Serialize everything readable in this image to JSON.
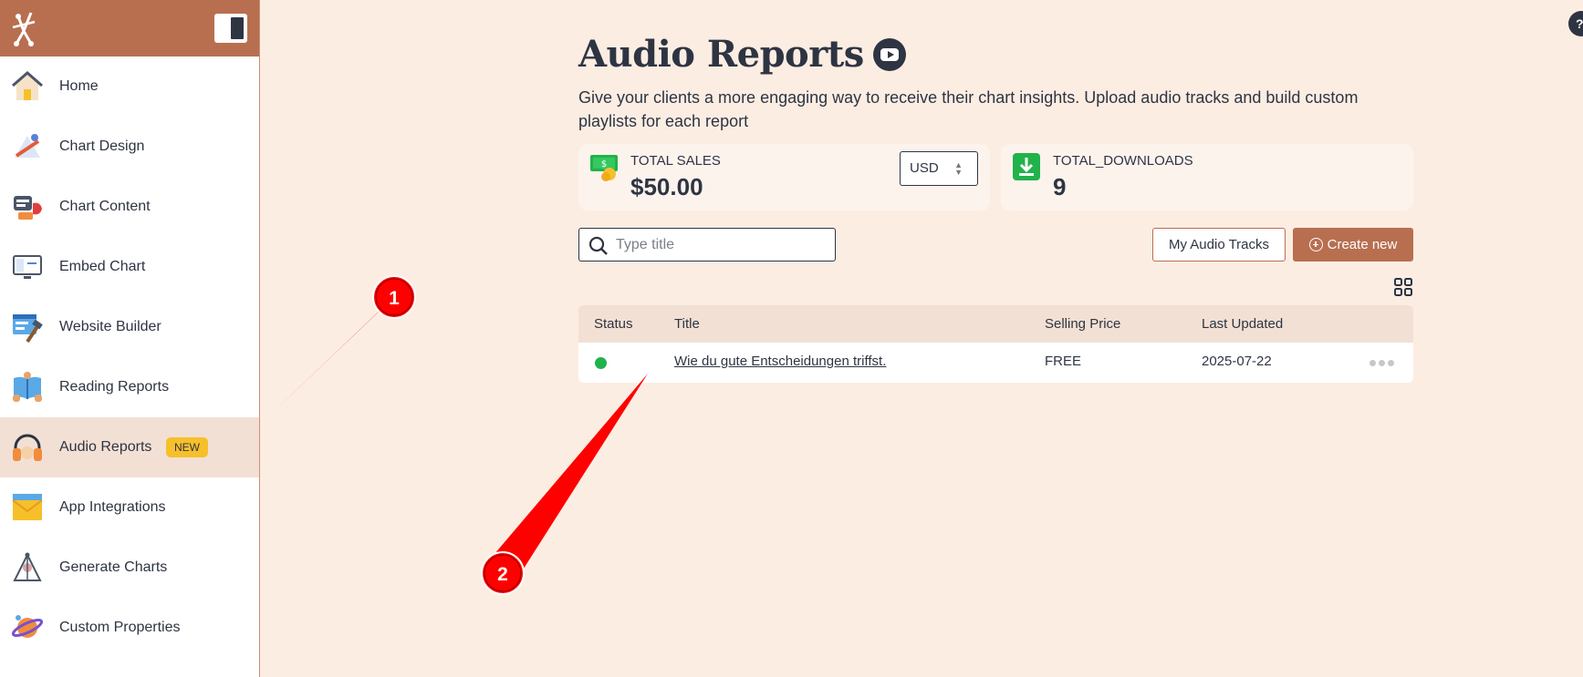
{
  "sidebar": {
    "items": [
      {
        "label": "Home"
      },
      {
        "label": "Chart Design"
      },
      {
        "label": "Chart Content"
      },
      {
        "label": "Embed Chart"
      },
      {
        "label": "Website Builder"
      },
      {
        "label": "Reading Reports"
      },
      {
        "label": "Audio Reports",
        "badge": "NEW",
        "active": true
      },
      {
        "label": "App Integrations"
      },
      {
        "label": "Generate Charts"
      },
      {
        "label": "Custom Properties"
      }
    ]
  },
  "page": {
    "title": "Audio Reports",
    "subtitle": "Give your clients a more engaging way to receive their chart insights. Upload audio tracks and build custom playlists for each report"
  },
  "stats": {
    "sales_label": "TOTAL SALES",
    "sales_value": "$50.00",
    "currency": "USD",
    "downloads_label": "TOTAL_DOWNLOADS",
    "downloads_value": "9"
  },
  "search": {
    "placeholder": "Type title"
  },
  "actions": {
    "my_tracks": "My Audio Tracks",
    "create_new": "Create new"
  },
  "table": {
    "headers": {
      "status": "Status",
      "title": "Title",
      "price": "Selling Price",
      "updated": "Last Updated"
    },
    "rows": [
      {
        "title": "Wie du gute Entscheidungen triffst.",
        "price": "FREE",
        "updated": "2025-07-22",
        "status_color": "#21b24b"
      }
    ]
  },
  "help": {
    "label": "?"
  },
  "annotations": {
    "marker1": "1",
    "marker2": "2"
  },
  "colors": {
    "brand": "#b86f50",
    "active_bg": "#f3e0d4",
    "page_bg": "#fcede3",
    "badge": "#f6c02b",
    "annotation": "#ff0000"
  }
}
